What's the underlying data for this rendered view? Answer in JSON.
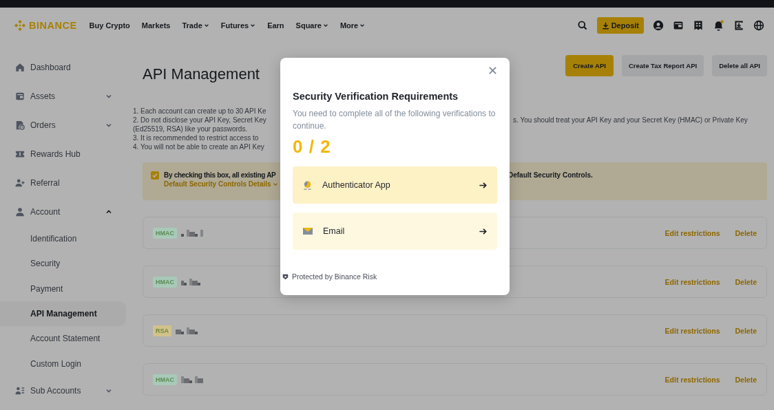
{
  "header": {
    "logo": "BINANCE",
    "nav": [
      {
        "label": "Buy Crypto",
        "has_menu": false
      },
      {
        "label": "Markets",
        "has_menu": false
      },
      {
        "label": "Trade",
        "has_menu": true
      },
      {
        "label": "Futures",
        "has_menu": true
      },
      {
        "label": "Earn",
        "has_menu": false
      },
      {
        "label": "Square",
        "has_menu": true
      },
      {
        "label": "More",
        "has_menu": true
      }
    ],
    "deposit": "Deposit",
    "notification": true
  },
  "sidebar": {
    "items": [
      {
        "label": "Dashboard",
        "kind": "home",
        "selected": false
      },
      {
        "label": "Assets",
        "kind": "wallet",
        "selected": false,
        "expanded": false
      },
      {
        "label": "Orders",
        "kind": "orders",
        "selected": false,
        "expanded": false
      },
      {
        "label": "Rewards Hub",
        "kind": "ticket",
        "selected": false
      },
      {
        "label": "Referral",
        "kind": "user-plus",
        "selected": false
      },
      {
        "label": "Account",
        "kind": "user",
        "selected": false,
        "expanded": true,
        "children": [
          {
            "label": "Identification",
            "selected": false
          },
          {
            "label": "Security",
            "selected": false
          },
          {
            "label": "Payment",
            "selected": false
          },
          {
            "label": "API Management",
            "selected": true
          },
          {
            "label": "Account Statement",
            "selected": false
          },
          {
            "label": "Custom Login",
            "selected": false
          }
        ]
      },
      {
        "label": "Sub Accounts",
        "kind": "users-list",
        "selected": false,
        "expanded": false
      }
    ]
  },
  "page": {
    "title": "API Management",
    "actions": [
      {
        "label": "Create API",
        "kind": "primary"
      },
      {
        "label": "Create Tax Report API",
        "kind": "secondary"
      },
      {
        "label": "Delete all API",
        "kind": "secondary"
      }
    ],
    "notes": [
      {
        "left": "1. Each account can create up to 30 API Ke"
      },
      {
        "left": "2. Do not disclose your API Key, Secret Key",
        "right": "s. You should treat your API Key and your Secret Key (HMAC) or Private Key"
      },
      {
        "left": "(Ed25519, RSA) like your passwords."
      },
      {
        "left": "3. It is recommended to restrict access to"
      },
      {
        "left": "4. You will not be able to create an API Key"
      }
    ],
    "notice": {
      "checked": true,
      "text_left": "By checking this box, all existing AP",
      "text_right": "Default Security Controls.",
      "link": "Default Security Controls Details"
    },
    "api_keys": [
      {
        "type": "HMAC",
        "color": "#a8c9b8",
        "edit": "Edit restrictions",
        "delete": "Delete"
      },
      {
        "type": "HMAC",
        "color": "#a8c9b8",
        "edit": "Edit restrictions",
        "delete": "Delete"
      },
      {
        "type": "RSA",
        "color": "#d2c28a",
        "edit": "Edit restrictions",
        "delete": "Delete"
      },
      {
        "type": "HMAC",
        "color": "#a8c9b8",
        "edit": "Edit restrictions",
        "delete": "Delete"
      }
    ]
  },
  "modal": {
    "title": "Security Verification Requirements",
    "subtitle": "You need to complete all of the following verifications to continue.",
    "progress": "0 / 2",
    "options": [
      {
        "kind": "authenticator",
        "label": "Authenticator App",
        "highlighted": true
      },
      {
        "kind": "email",
        "label": "Email",
        "highlighted": false
      }
    ],
    "footer": "Protected by Binance Risk"
  }
}
